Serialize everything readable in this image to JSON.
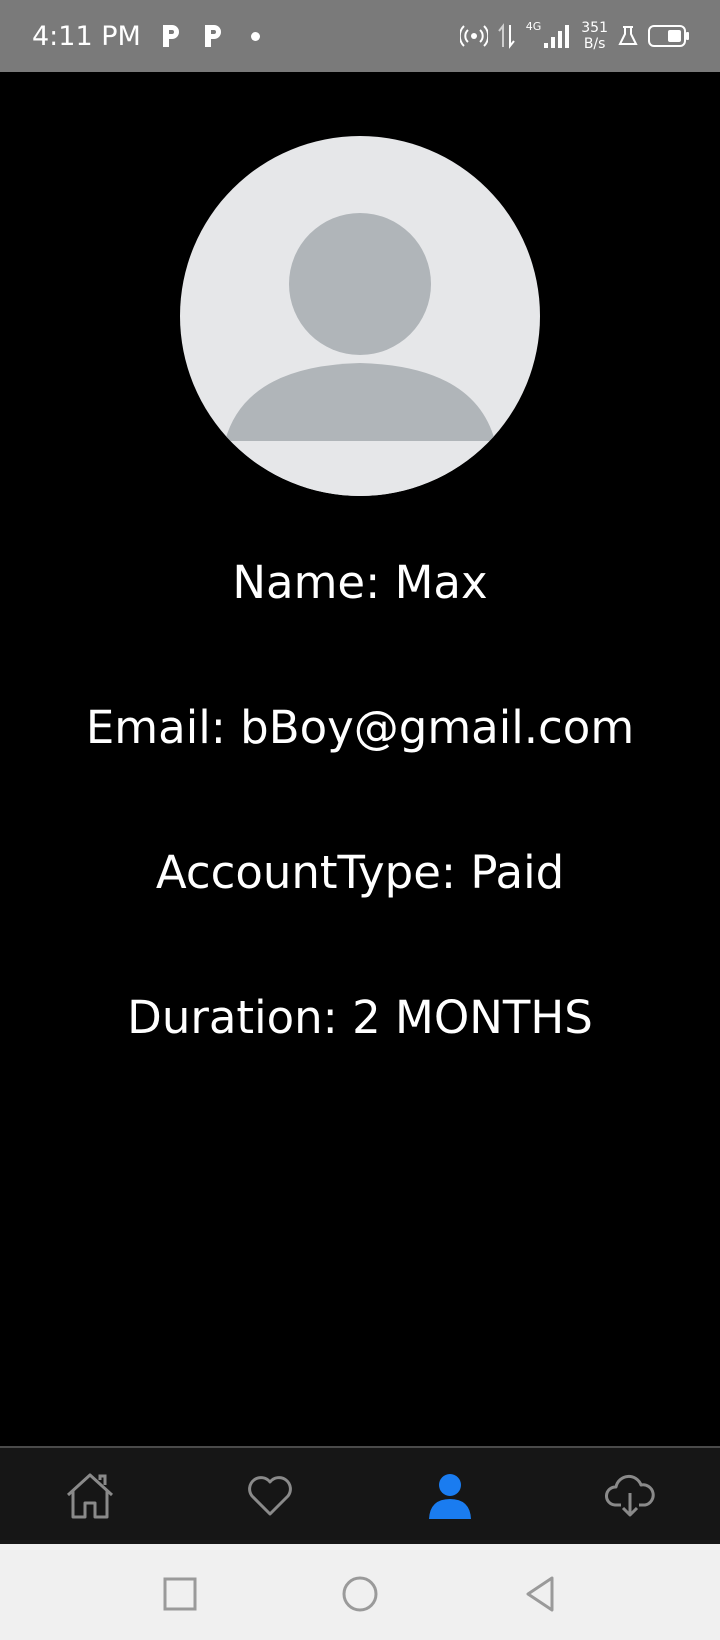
{
  "status_bar": {
    "time": "4:11 PM",
    "network_type": "4G",
    "speed_value": "351",
    "speed_unit": "B/s",
    "icons": [
      "p-app-icon",
      "p-app-icon",
      "notification-dot",
      "hotspot-icon",
      "data-arrows-icon",
      "signal-icon",
      "lab-icon",
      "battery-icon"
    ]
  },
  "profile": {
    "name_line": "Name: Max",
    "email_line": "Email: bBoy@gmail.com",
    "account_type_line": "AccountType: Paid",
    "duration_line": "Duration: 2 MONTHS"
  },
  "bottom_nav": {
    "items": [
      {
        "icon": "home-icon",
        "active": false
      },
      {
        "icon": "heart-icon",
        "active": false
      },
      {
        "icon": "profile-icon",
        "active": true
      },
      {
        "icon": "cloud-download-icon",
        "active": false
      }
    ],
    "active_color": "#1a7cf0",
    "inactive_color": "#8a8a8a"
  },
  "system_nav": {
    "buttons": [
      "recents-button",
      "home-button",
      "back-button"
    ]
  },
  "colors": {
    "status_bar_bg": "#7a7a7a",
    "background": "#000000",
    "avatar_bg": "#e6e7e9",
    "avatar_figure": "#b0b5b9",
    "text": "#ffffff"
  }
}
